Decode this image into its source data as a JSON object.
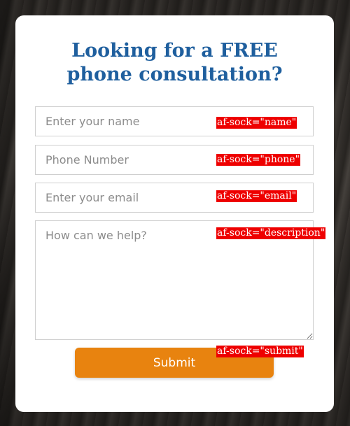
{
  "form": {
    "title_line1": "Looking for a FREE",
    "title_line2": "phone consultation?",
    "name_placeholder": "Enter your name",
    "phone_placeholder": "Phone Number",
    "email_placeholder": "Enter your email",
    "description_placeholder": "How can we help?",
    "submit_label": "Submit"
  },
  "annotations": {
    "name": "af-sock=\"name\"",
    "phone": "af-sock=\"phone\"",
    "email": "af-sock=\"email\"",
    "description": "af-sock=\"description\"",
    "submit": "af-sock=\"submit\""
  },
  "colors": {
    "title": "#1f5f9e",
    "submit_background": "#e8830f",
    "annotation_background": "#ee0000"
  }
}
